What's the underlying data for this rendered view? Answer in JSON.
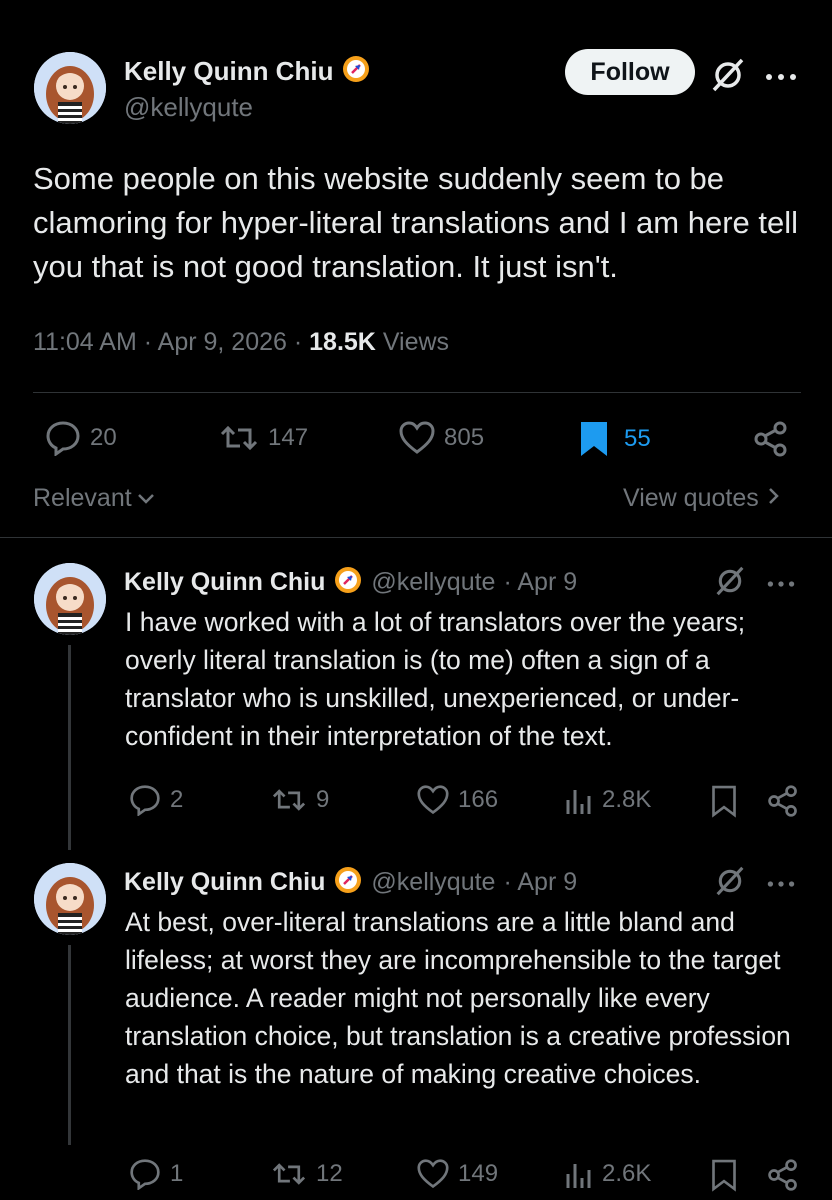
{
  "main_tweet": {
    "author_name": "Kelly Quinn Chiu",
    "handle": "@kellyqute",
    "follow_label": "Follow",
    "text": "Some people on this website suddenly seem to be clamoring for hyper-literal translations and I am here tell you that is not good translation. It just isn't.",
    "time": "11:04 AM",
    "date": "Apr 9, 2026",
    "views_count": "18.5K",
    "views_label": "Views",
    "replies": "20",
    "reposts": "147",
    "likes": "805",
    "bookmarks": "55"
  },
  "sort_label": "Relevant",
  "view_quotes_label": "View quotes",
  "replies": [
    {
      "author_name": "Kelly Quinn Chiu",
      "handle": "@kellyqute",
      "date": "· Apr 9",
      "text": "I have worked with a lot of translators over the years; overly literal translation is (to me) often a sign of a translator who is unskilled, unexperienced, or under-confident in their interpretation of the text.",
      "replies": "2",
      "reposts": "9",
      "likes": "166",
      "views": "2.8K"
    },
    {
      "author_name": "Kelly Quinn Chiu",
      "handle": "@kellyqute",
      "date": "· Apr 9",
      "text": "At best, over-literal translations are a little bland and lifeless; at worst they are incomprehensible to the target audience. A reader might not personally like every translation choice, but translation is a creative profession and that is the nature of making creative choices.",
      "replies": "1",
      "reposts": "12",
      "likes": "149",
      "views": "2.6K"
    }
  ],
  "icons": {
    "verified": "orange-verified-badge-icon",
    "grok": "grok-icon",
    "more": "more-dots-icon",
    "reply": "reply-icon",
    "repost": "repost-icon",
    "like": "heart-icon",
    "bookmark": "bookmark-icon",
    "share": "share-icon",
    "views": "views-chart-icon"
  },
  "colors": {
    "background": "#000000",
    "text": "#e7e9ea",
    "muted": "#71767b",
    "accent_blue": "#1d9bf0",
    "badge_orange": "#f6a01a"
  }
}
